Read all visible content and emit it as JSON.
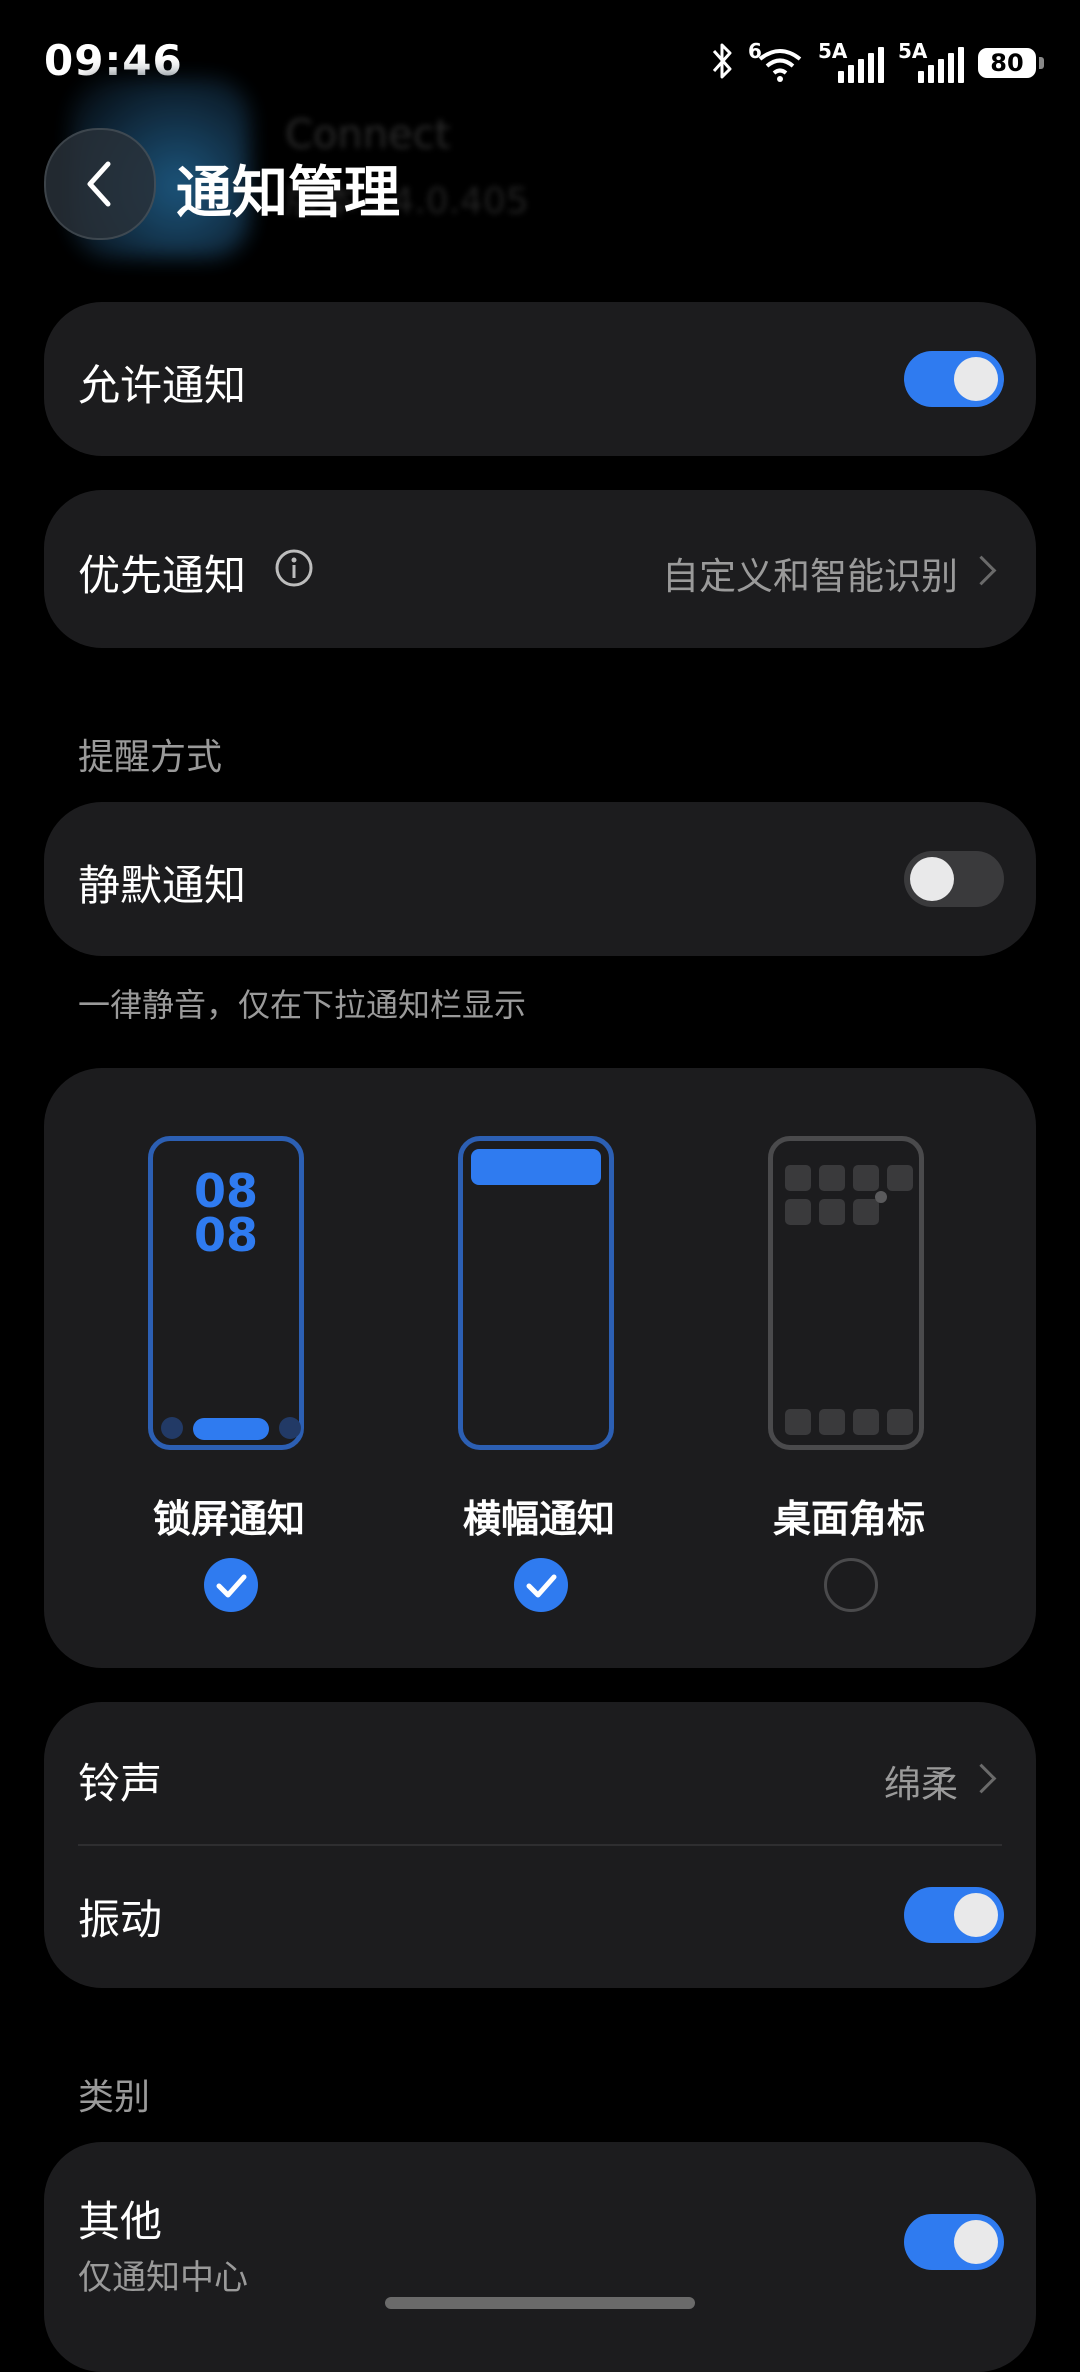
{
  "status_bar": {
    "time": "09:46",
    "wifi_tag": "6",
    "sim1_tag": "5A",
    "sim2_tag": "5A",
    "battery": "80"
  },
  "header": {
    "title": "通知管理",
    "app_name_blurred": "Connect",
    "app_version_blurred": "版本 14.0.405"
  },
  "allow_notifications": {
    "label": "允许通知",
    "on": true
  },
  "priority_notifications": {
    "label": "优先通知",
    "value": "自定义和智能识别"
  },
  "alert_section": {
    "title": "提醒方式",
    "silent": {
      "label": "静默通知",
      "on": false
    },
    "silent_hint": "一律静音，仅在下拉通知栏显示"
  },
  "display_styles": [
    {
      "label": "锁屏通知",
      "checked": true,
      "preview_clock": "08\n08"
    },
    {
      "label": "横幅通知",
      "checked": true
    },
    {
      "label": "桌面角标",
      "checked": false
    }
  ],
  "sound_card": {
    "ringtone": {
      "label": "铃声",
      "value": "绵柔"
    },
    "vibration": {
      "label": "振动",
      "on": true
    }
  },
  "category_section": {
    "title": "类别",
    "other": {
      "label": "其他",
      "sublabel": "仅通知中心",
      "on": true
    }
  },
  "colors": {
    "accent": "#2f7bf0",
    "card": "#1c1c1e",
    "secondary_text": "#9a9a9a"
  }
}
